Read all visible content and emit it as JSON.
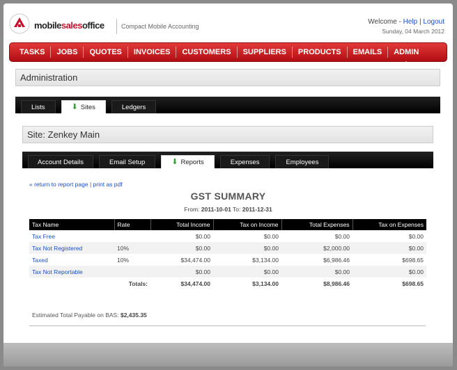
{
  "header": {
    "brand_left": "mobile",
    "brand_mid": "sales",
    "brand_right": "office",
    "tagline": "Compact Mobile Accounting",
    "welcome": "Welcome -",
    "help": "Help",
    "logout": "Logout",
    "date": "Sunday, 04 March 2012"
  },
  "nav": [
    "TASKS",
    "JOBS",
    "QUOTES",
    "INVOICES",
    "CUSTOMERS",
    "SUPPLIERS",
    "PRODUCTS",
    "EMAILS",
    "ADMIN"
  ],
  "admin": {
    "title": "Administration",
    "tabs": [
      "Lists",
      "Sites",
      "Ledgers"
    ]
  },
  "site": {
    "title": "Site: Zenkey Main",
    "tabs": [
      "Account Details",
      "Email Setup",
      "Reports",
      "Expenses",
      "Employees"
    ]
  },
  "report": {
    "return_link": "« return to report page",
    "print_link": "print as pdf",
    "title": "GST SUMMARY",
    "from_label": "From:",
    "from": "2011-10-01",
    "to_label": "To:",
    "to": "2011-12-31",
    "columns": [
      "Tax Name",
      "Rate",
      "Total Income",
      "Tax on Income",
      "Total Expenses",
      "Tax on Expenses"
    ],
    "rows": [
      {
        "name": "Tax Free",
        "rate": "",
        "income": "$0.00",
        "tax_income": "$0.00",
        "expenses": "$0.00",
        "tax_expenses": "$0.00"
      },
      {
        "name": "Tax Not Registered",
        "rate": "10%",
        "income": "$0.00",
        "tax_income": "$0.00",
        "expenses": "$2,000.00",
        "tax_expenses": "$0.00"
      },
      {
        "name": "Taxed",
        "rate": "10%",
        "income": "$34,474.00",
        "tax_income": "$3,134.00",
        "expenses": "$6,986.46",
        "tax_expenses": "$698.65"
      },
      {
        "name": "Tax Not Reportable",
        "rate": "",
        "income": "$0.00",
        "tax_income": "$0.00",
        "expenses": "$0.00",
        "tax_expenses": "$0.00"
      }
    ],
    "totals": {
      "label": "Totals:",
      "income": "$34,474.00",
      "tax_income": "$3,134.00",
      "expenses": "$8,986.46",
      "tax_expenses": "$698.65"
    },
    "payable_label": "Estimated Total Payable on BAS:",
    "payable_value": "$2,435.35"
  },
  "colors": {
    "nav_red": "#c8102e",
    "link_blue": "#1c4fc3",
    "tab_arrow": "#3aa035"
  }
}
